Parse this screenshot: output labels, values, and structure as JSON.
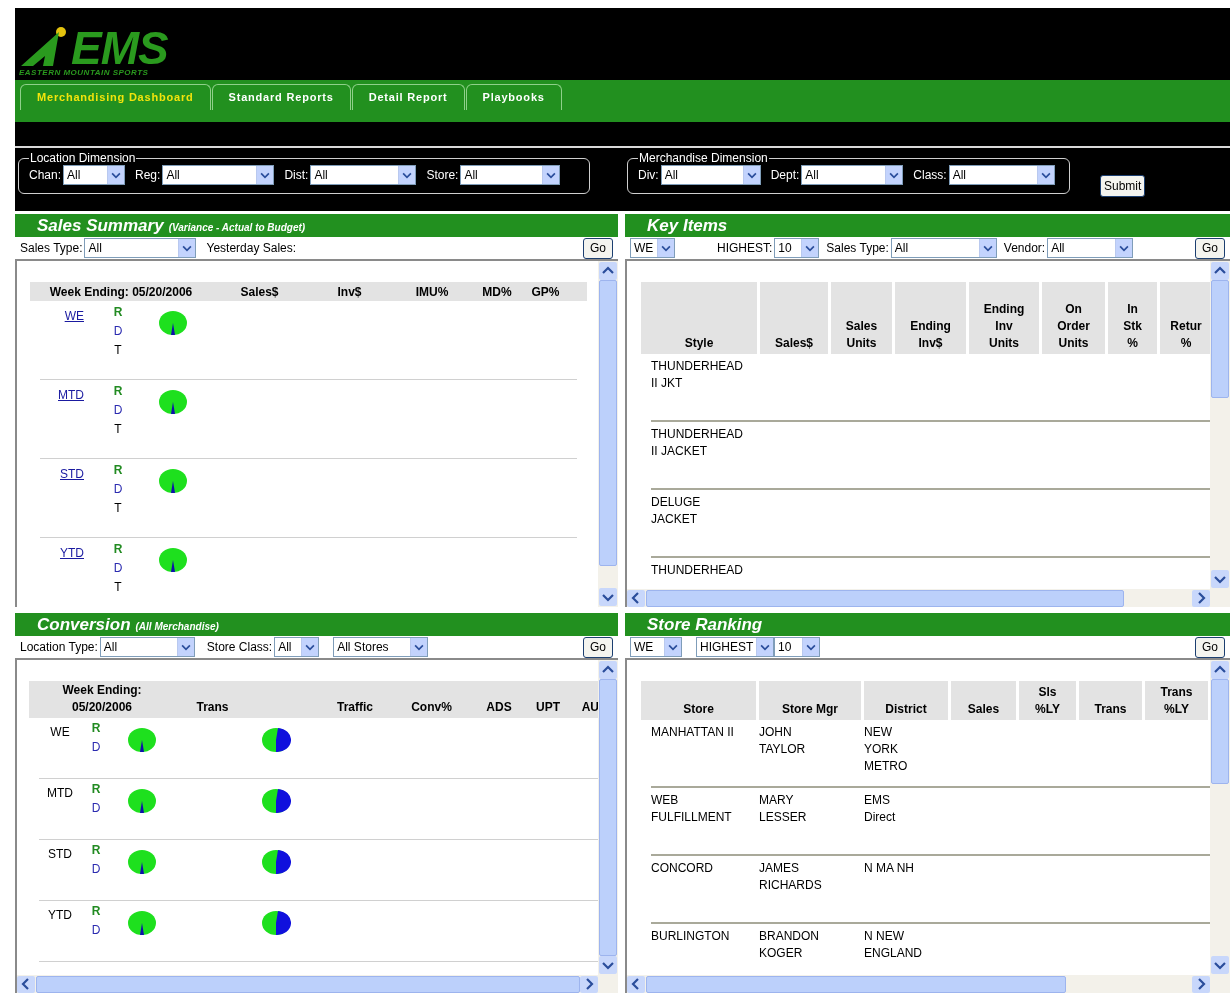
{
  "logo": {
    "mark": "EMS",
    "tagline": "EASTERN MOUNTAIN SPORTS"
  },
  "tabs": [
    {
      "label": "Merchandising Dashboard",
      "selected": true
    },
    {
      "label": "Standard Reports",
      "selected": false
    },
    {
      "label": "Detail Report",
      "selected": false
    },
    {
      "label": "Playbooks",
      "selected": false
    }
  ],
  "location_dimension": {
    "legend": "Location Dimension",
    "filters": [
      {
        "label": "Chan:",
        "value": "All"
      },
      {
        "label": "Reg:",
        "value": "All"
      },
      {
        "label": "Dist:",
        "value": "All"
      },
      {
        "label": "Store:",
        "value": "All"
      }
    ]
  },
  "merchandise_dimension": {
    "legend": "Merchandise Dimension",
    "filters": [
      {
        "label": "Div:",
        "value": "All"
      },
      {
        "label": "Dept:",
        "value": "All"
      },
      {
        "label": "Class:",
        "value": "All"
      }
    ]
  },
  "submit_button": "Submit",
  "sales_summary": {
    "title": "Sales Summary",
    "subtitle": "(Variance - Actual to Budget)",
    "controls": [
      {
        "kind": "select",
        "label": "Sales Type:",
        "value": "All"
      },
      {
        "kind": "text",
        "text": "Yesterday Sales:"
      }
    ],
    "go_button": "Go",
    "columns": [
      "Week Ending: 05/20/2006",
      "Sales$",
      "Inv$",
      "IMU%",
      "MD%",
      "GP%"
    ],
    "rows": [
      {
        "period": "WE",
        "link": true,
        "lines": [
          {
            "text": "R",
            "color": "#228b22"
          },
          {
            "text": "D",
            "color": "#2b2bb0"
          },
          {
            "text": "T",
            "color": "#000000"
          }
        ]
      },
      {
        "period": "MTD",
        "link": true,
        "lines": [
          {
            "text": "R",
            "color": "#228b22"
          },
          {
            "text": "D",
            "color": "#2b2bb0"
          },
          {
            "text": "T",
            "color": "#000000"
          }
        ]
      },
      {
        "period": "STD",
        "link": true,
        "lines": [
          {
            "text": "R",
            "color": "#228b22"
          },
          {
            "text": "D",
            "color": "#2b2bb0"
          },
          {
            "text": "T",
            "color": "#000000"
          }
        ]
      },
      {
        "period": "YTD",
        "link": true,
        "lines": [
          {
            "text": "R",
            "color": "#228b22"
          },
          {
            "text": "D",
            "color": "#2b2bb0"
          },
          {
            "text": "T",
            "color": "#000000"
          }
        ]
      }
    ]
  },
  "key_items": {
    "title": "Key Items",
    "controls": [
      {
        "kind": "select",
        "value": "WE"
      },
      {
        "kind": "select",
        "label": "HIGHEST:",
        "value": "10"
      },
      {
        "kind": "select",
        "label": "Sales Type:",
        "value": "All"
      },
      {
        "kind": "select",
        "label": "Vendor:",
        "value": "All"
      }
    ],
    "go_button": "Go",
    "columns": [
      "Style",
      "Sales$",
      "Sales Units",
      "Ending Inv$",
      "Ending Inv Units",
      "On Order Units",
      "In Stk %",
      "Retur %"
    ],
    "rows": [
      {
        "cells": [
          "THUNDERHEAD II JKT"
        ]
      },
      {
        "cells": [
          "THUNDERHEAD II JACKET"
        ]
      },
      {
        "cells": [
          "DELUGE JACKET"
        ]
      },
      {
        "cells": [
          "THUNDERHEAD"
        ]
      }
    ]
  },
  "conversion": {
    "title": "Conversion",
    "subtitle": "(All Merchandise)",
    "controls": [
      {
        "kind": "select",
        "label": "Location Type:",
        "value": "All"
      },
      {
        "kind": "select",
        "label": "Store Class:",
        "value": "All"
      },
      {
        "kind": "select",
        "value": "All Stores"
      }
    ],
    "go_button": "Go",
    "columns": [
      "Week Ending: 05/20/2006",
      "Trans",
      "Traffic",
      "Conv%",
      "ADS",
      "UPT",
      "AU"
    ],
    "rows": [
      {
        "period": "WE",
        "link": false,
        "lines": [
          {
            "text": "R",
            "color": "#228b22"
          },
          {
            "text": "D",
            "color": "#2b2bb0"
          }
        ]
      },
      {
        "period": "MTD",
        "link": false,
        "lines": [
          {
            "text": "R",
            "color": "#228b22"
          },
          {
            "text": "D",
            "color": "#2b2bb0"
          }
        ]
      },
      {
        "period": "STD",
        "link": false,
        "lines": [
          {
            "text": "R",
            "color": "#228b22"
          },
          {
            "text": "D",
            "color": "#2b2bb0"
          }
        ]
      },
      {
        "period": "YTD",
        "link": false,
        "lines": [
          {
            "text": "R",
            "color": "#228b22"
          },
          {
            "text": "D",
            "color": "#2b2bb0"
          }
        ]
      }
    ]
  },
  "store_ranking": {
    "title": "Store Ranking",
    "controls": [
      {
        "kind": "select",
        "value": "WE"
      },
      {
        "kind": "select",
        "value": "HIGHEST"
      },
      {
        "kind": "select",
        "value": "10"
      }
    ],
    "go_button": "Go",
    "columns": [
      "Store",
      "Store Mgr",
      "District",
      "Sales",
      "Sls %LY",
      "Trans",
      "Trans %LY"
    ],
    "rows": [
      {
        "cells": [
          "MANHATTAN II",
          "JOHN TAYLOR",
          "NEW YORK METRO"
        ]
      },
      {
        "cells": [
          "WEB FULFILLMENT",
          "MARY LESSER",
          "EMS Direct"
        ]
      },
      {
        "cells": [
          "CONCORD",
          "JAMES RICHARDS",
          "N MA NH"
        ]
      },
      {
        "cells": [
          "BURLINGTON",
          "BRANDON KOGER",
          "N NEW ENGLAND"
        ]
      }
    ]
  }
}
